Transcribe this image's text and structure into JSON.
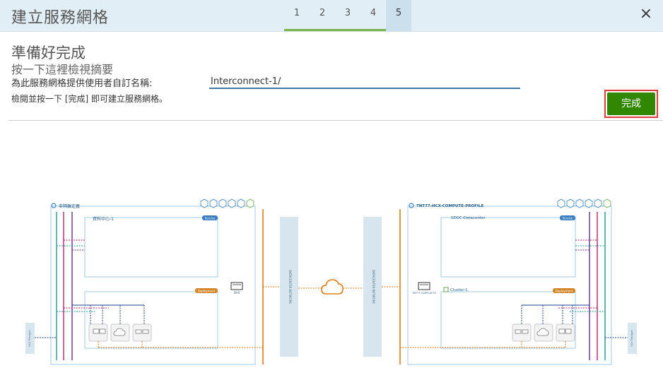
{
  "header": {
    "title": "建立服務網格",
    "steps": [
      "1",
      "2",
      "3",
      "4",
      "5"
    ],
    "close_label": "×"
  },
  "main": {
    "heading": "準備好完成",
    "subheading": "按一下這裡檢視摘要",
    "name_label": "為此服務網格提供使用者自訂名稱:",
    "name_value": "Interconnect-1/",
    "review_text": "檢閱並按一下 [完成] 即可建立服務網格。",
    "finish_label": "完成"
  },
  "diagram": {
    "left_site": {
      "name": "非隔離定義",
      "datacenter": "資料中心-1",
      "service_badge": "Service",
      "deployment_badge": "Deployment",
      "dvs_label": "DVS"
    },
    "right_site": {
      "name": "TNT77-HCX-COMPUTE-PROFILE",
      "datacenter": "SDDC-Datacenter",
      "service_badge": "Service",
      "deployment_badge": "Deployment",
      "cluster": "Cluster-1",
      "overlay_label": "TNT77-OVERLAY-TZ"
    },
    "network_label_left": "DATACENTER NETWORK",
    "network_label_right": "DATACENTER NETWORK",
    "left_remote": "HCX Manager",
    "right_remote": "HCX Manager",
    "colors": {
      "box_border": "#9fcbe4",
      "orange": "#e07b14",
      "magenta": "#b3226f",
      "purple": "#6a2c8e",
      "navy": "#1f3f8f",
      "teal": "#1e9a9a",
      "network_bar": "#d7e6ee",
      "badge_blue": "#3a7fc1",
      "badge_orange": "#d3852a"
    }
  }
}
